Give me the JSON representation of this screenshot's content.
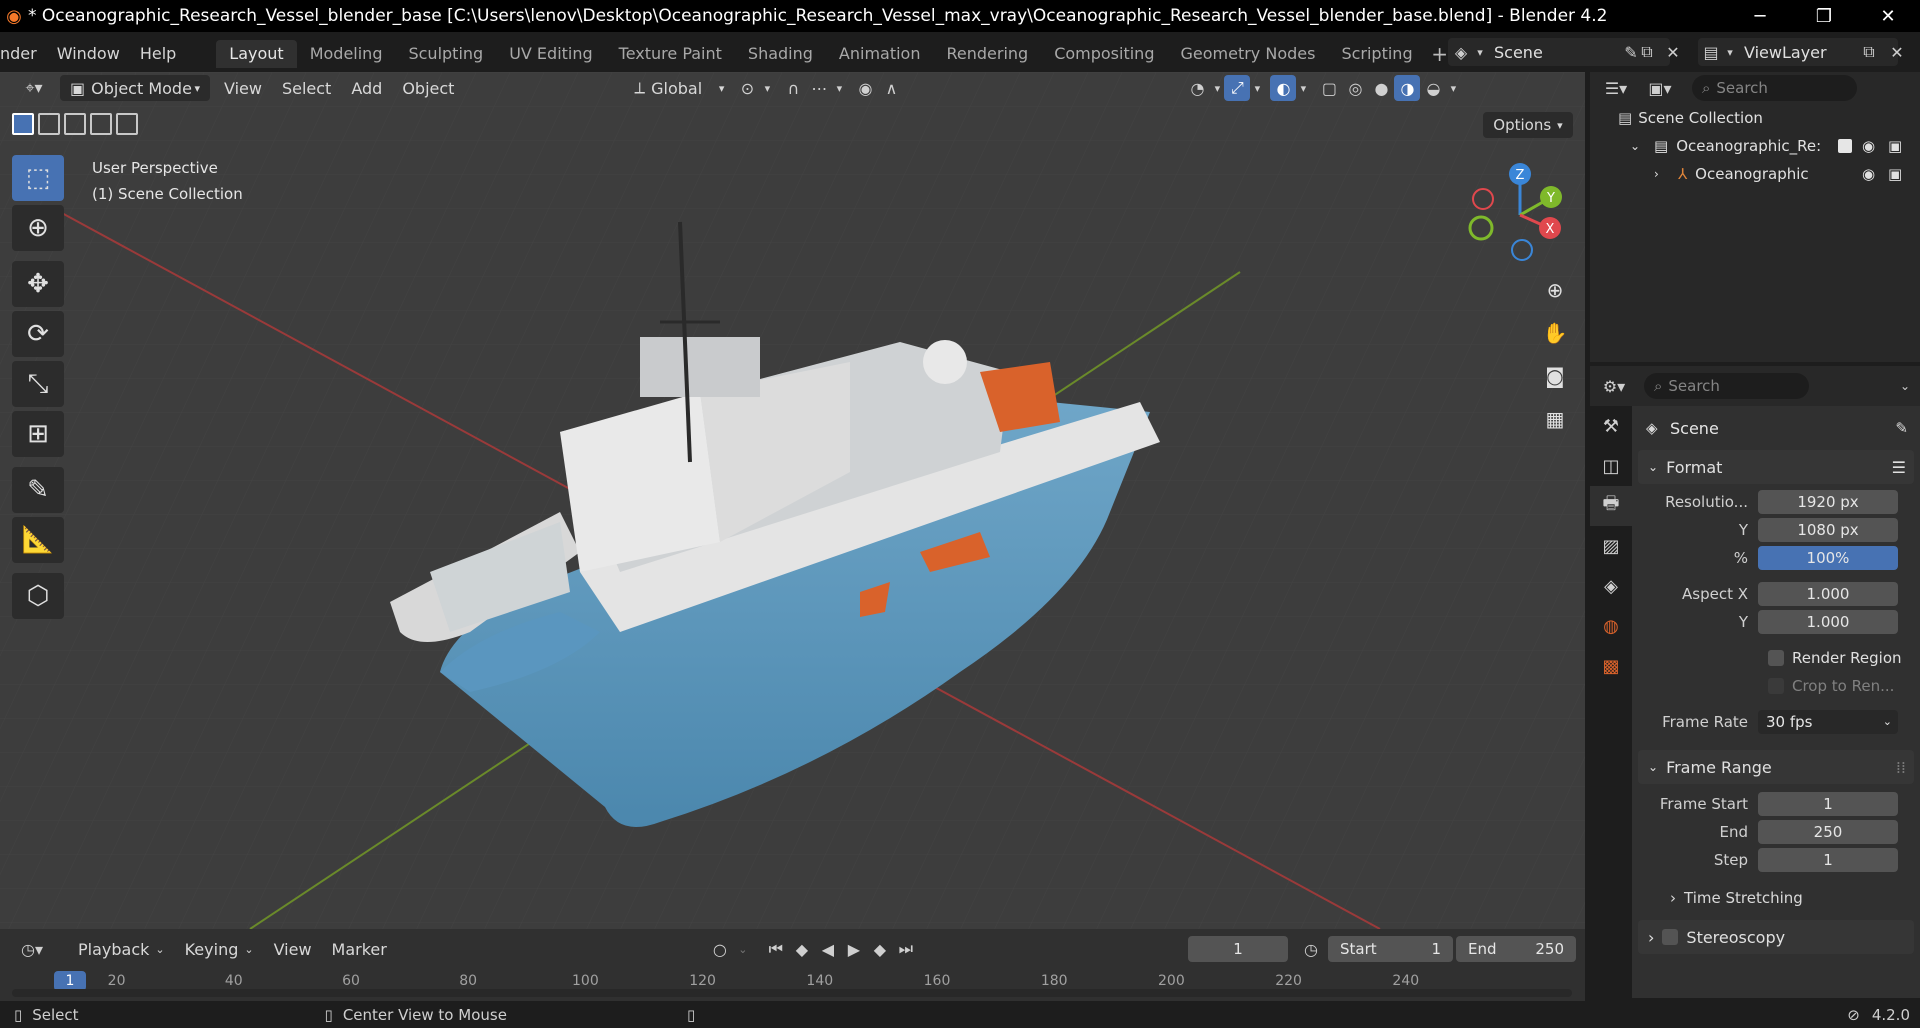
{
  "title_bar": {
    "title": "* Oceanographic_Research_Vessel_blender_base [C:\\Users\\lenov\\Desktop\\Oceanographic_Research_Vessel_max_vray\\Oceanographic_Research_Vessel_blender_base.blend] - Blender 4.2",
    "minimize": "─",
    "maximize": "❐",
    "close": "✕"
  },
  "menu": {
    "items": [
      "nder",
      "Window",
      "Help"
    ],
    "workspaces": [
      "Layout",
      "Modeling",
      "Sculpting",
      "UV Editing",
      "Texture Paint",
      "Shading",
      "Animation",
      "Rendering",
      "Compositing",
      "Geometry Nodes",
      "Scripting"
    ],
    "active_workspace": "Layout",
    "plus": "+",
    "scene_label": "Scene",
    "view_layer_label": "ViewLayer"
  },
  "viewport": {
    "mode": "Object Mode",
    "menus": [
      "View",
      "Select",
      "Add",
      "Object"
    ],
    "transform_orientation": "Global",
    "options_label": "Options",
    "overlay_line1": "User Perspective",
    "overlay_line2": "(1) Scene Collection",
    "gizmo_axes": {
      "x": "X",
      "y": "Y",
      "z": "Z"
    },
    "colors": {
      "x_axis": "#e0484d",
      "y_axis": "#7fb92b",
      "z_axis": "#3a86d8",
      "accent": "#4772b3"
    }
  },
  "outliner": {
    "search_placeholder": "Search",
    "rows": [
      {
        "label": "Scene Collection"
      },
      {
        "label": "Oceanographic_Re:"
      },
      {
        "label": "Oceanographic"
      }
    ]
  },
  "properties": {
    "search_placeholder": "Search",
    "context": "Scene",
    "format": {
      "title": "Format",
      "resolution_label": "Resolutio...",
      "resolution_x": "1920 px",
      "y_label": "Y",
      "resolution_y": "1080 px",
      "percent_label": "%",
      "percent": "100%",
      "aspect_x_label": "Aspect X",
      "aspect_x": "1.000",
      "aspect_y_label": "Y",
      "aspect_y": "1.000",
      "render_region": "Render Region",
      "crop": "Crop to Ren...",
      "frame_rate_label": "Frame Rate",
      "frame_rate": "30 fps"
    },
    "frame_range": {
      "title": "Frame Range",
      "start_label": "Frame Start",
      "start": "1",
      "end_label": "End",
      "end": "250",
      "step_label": "Step",
      "step": "1",
      "time_stretching": "Time Stretching",
      "stereoscopy": "Stereoscopy"
    }
  },
  "timeline": {
    "menus": [
      "Playback",
      "Keying",
      "View",
      "Marker"
    ],
    "current_frame": "1",
    "start_label": "Start",
    "start": "1",
    "end_label": "End",
    "end": "250",
    "ticks": [
      "20",
      "40",
      "60",
      "80",
      "100",
      "120",
      "140",
      "160",
      "180",
      "200",
      "220",
      "240"
    ],
    "playhead": "1"
  },
  "status": {
    "select": "Select",
    "center_view": "Center View to Mouse",
    "version": "4.2.0"
  }
}
